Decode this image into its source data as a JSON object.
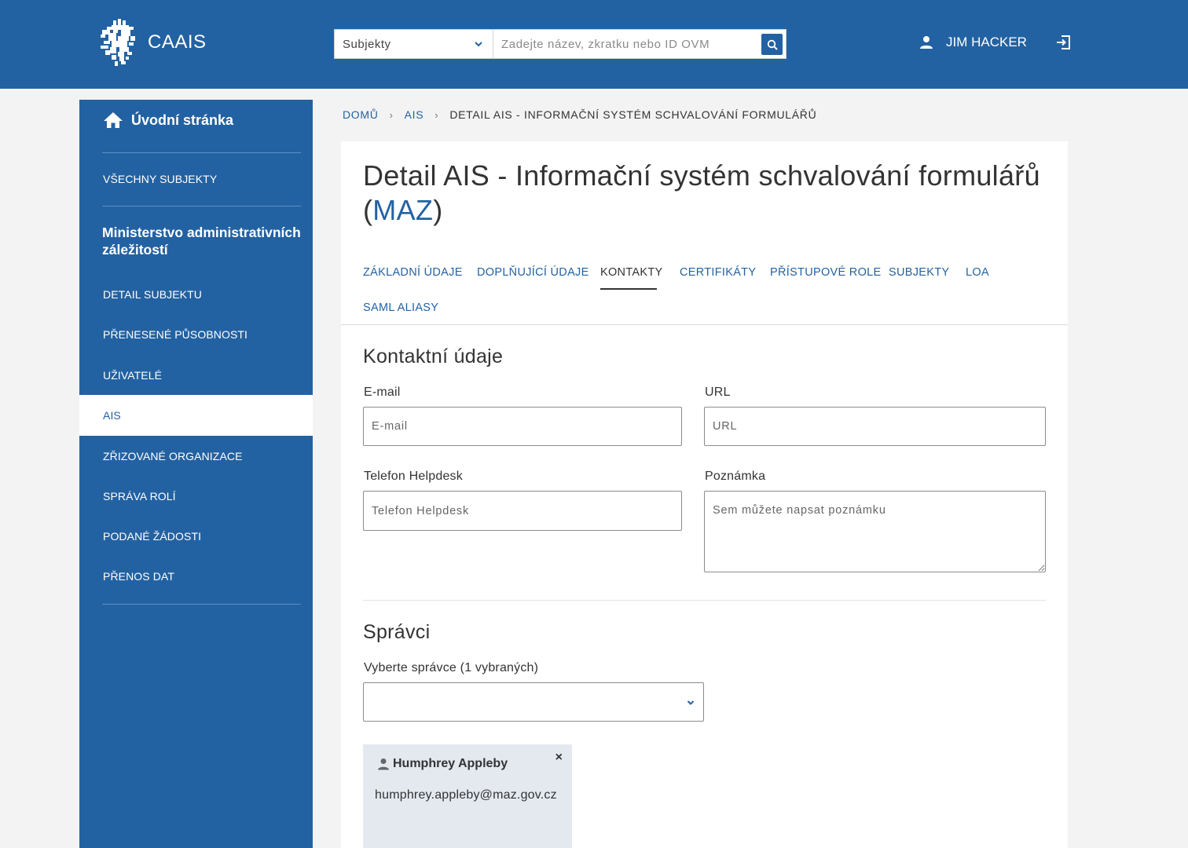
{
  "header": {
    "app_name": "CAAIS",
    "search": {
      "select_value": "Subjekty",
      "placeholder": "Zadejte název, zkratku nebo ID OVM",
      "value": ""
    },
    "user_name": "JIM HACKER",
    "brand_color": "#2362a2"
  },
  "sidebar": {
    "home_label": "Úvodní stránka",
    "all_subjects_label": "VŠECHNY SUBJEKTY",
    "organization_name": "Ministerstvo administrativních záležitostí",
    "items": [
      {
        "label": "DETAIL SUBJEKTU",
        "active": false
      },
      {
        "label": "PŘENESENÉ PŮSOBNOSTI",
        "active": false
      },
      {
        "label": "UŽIVATELÉ",
        "active": false
      },
      {
        "label": "AIS",
        "active": true
      },
      {
        "label": "ZŘIZOVANÉ ORGANIZACE",
        "active": false
      },
      {
        "label": "SPRÁVA ROLÍ",
        "active": false
      },
      {
        "label": "PODANÉ ŽÁDOSTI",
        "active": false
      },
      {
        "label": "PŘENOS DAT",
        "active": false
      }
    ]
  },
  "breadcrumb": {
    "home": "DOMŮ",
    "ais": "AIS",
    "current": "DETAIL AIS - INFORMAČNÍ SYSTÉM SCHVALOVÁNÍ FORMULÁŘŮ"
  },
  "page": {
    "title": "Detail AIS - Informační systém schvalování formulářů",
    "abbr": "MAZ"
  },
  "tabs": [
    {
      "label": "ZÁKLADNÍ ÚDAJE",
      "active": false
    },
    {
      "label": "DOPLŇUJÍCÍ ÚDAJE",
      "active": false
    },
    {
      "label": "KONTAKTY",
      "active": true
    },
    {
      "label": "CERTIFIKÁTY",
      "active": false
    },
    {
      "label": "PŘÍSTUPOVÉ ROLE",
      "active": false
    },
    {
      "label": "SUBJEKTY",
      "active": false
    },
    {
      "label": "LOA",
      "active": false
    },
    {
      "label": "SAML ALIASY",
      "active": false
    }
  ],
  "contacts": {
    "section_title": "Kontaktní údaje",
    "email": {
      "label": "E-mail",
      "placeholder": "E-mail",
      "value": ""
    },
    "url": {
      "label": "URL",
      "placeholder": "URL",
      "value": ""
    },
    "phone": {
      "label": "Telefon Helpdesk",
      "placeholder": "Telefon Helpdesk",
      "value": ""
    },
    "note": {
      "label": "Poznámka",
      "placeholder": "Sem můžete napsat poznámku",
      "value": ""
    }
  },
  "admins": {
    "section_title": "Správci",
    "select_label": "Vyberte správce (1 vybraných)",
    "select_value": "",
    "selected": [
      {
        "name": "Humphrey Appleby",
        "email": "humphrey.appleby@maz.gov.cz",
        "close_glyph": "×"
      }
    ]
  }
}
